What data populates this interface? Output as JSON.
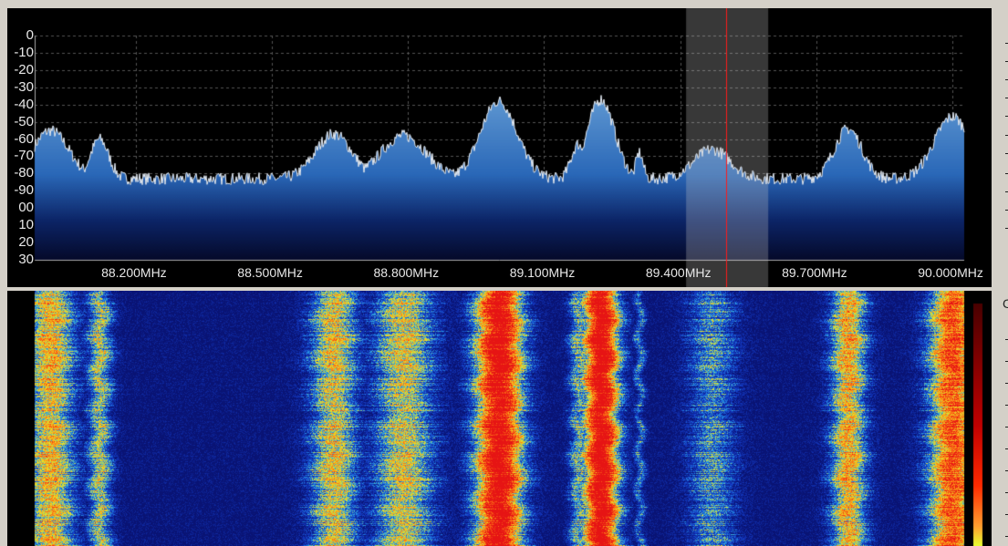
{
  "spectrum": {
    "y_labels": [
      "0",
      "-10",
      "-20",
      "-30",
      "-40",
      "-50",
      "-60",
      "-70",
      "-80",
      "-90",
      "00",
      "10",
      "20",
      "30"
    ],
    "y_range_db": [
      0,
      -130
    ],
    "x_labels": [
      "88.200MHz",
      "88.500MHz",
      "88.800MHz",
      "89.100MHz",
      "89.400MHz",
      "89.700MHz",
      "90.000MHz"
    ],
    "x_label_freqs": [
      88.2,
      88.5,
      88.8,
      89.1,
      89.4,
      89.7,
      90.0
    ],
    "freq_range_mhz": [
      87.977,
      90.026
    ],
    "noise_floor_db": -83,
    "tuned_freq_mhz": 89.501,
    "filter_band_mhz": [
      89.413,
      89.594
    ],
    "peaks": [
      {
        "freq": 88.012,
        "db": -55,
        "width": 0.04
      },
      {
        "freq": 88.12,
        "db": -60,
        "width": 0.02
      },
      {
        "freq": 88.636,
        "db": -57,
        "width": 0.04
      },
      {
        "freq": 88.79,
        "db": -58,
        "width": 0.05
      },
      {
        "freq": 89.0,
        "db": -38,
        "width": 0.04
      },
      {
        "freq": 89.175,
        "db": -63,
        "width": 0.015
      },
      {
        "freq": 89.225,
        "db": -37,
        "width": 0.03
      },
      {
        "freq": 89.31,
        "db": -68,
        "width": 0.008
      },
      {
        "freq": 89.47,
        "db": -66,
        "width": 0.04
      },
      {
        "freq": 89.77,
        "db": -54,
        "width": 0.03
      },
      {
        "freq": 90.0,
        "db": -47,
        "width": 0.04
      }
    ],
    "colors": {
      "fill_top": "#5a93cf",
      "fill_bottom": "#050a2a",
      "trace": "#e8eef5",
      "tuner_line": "#ff1a1a",
      "grid": "#555555"
    }
  },
  "side_label": "C"
}
